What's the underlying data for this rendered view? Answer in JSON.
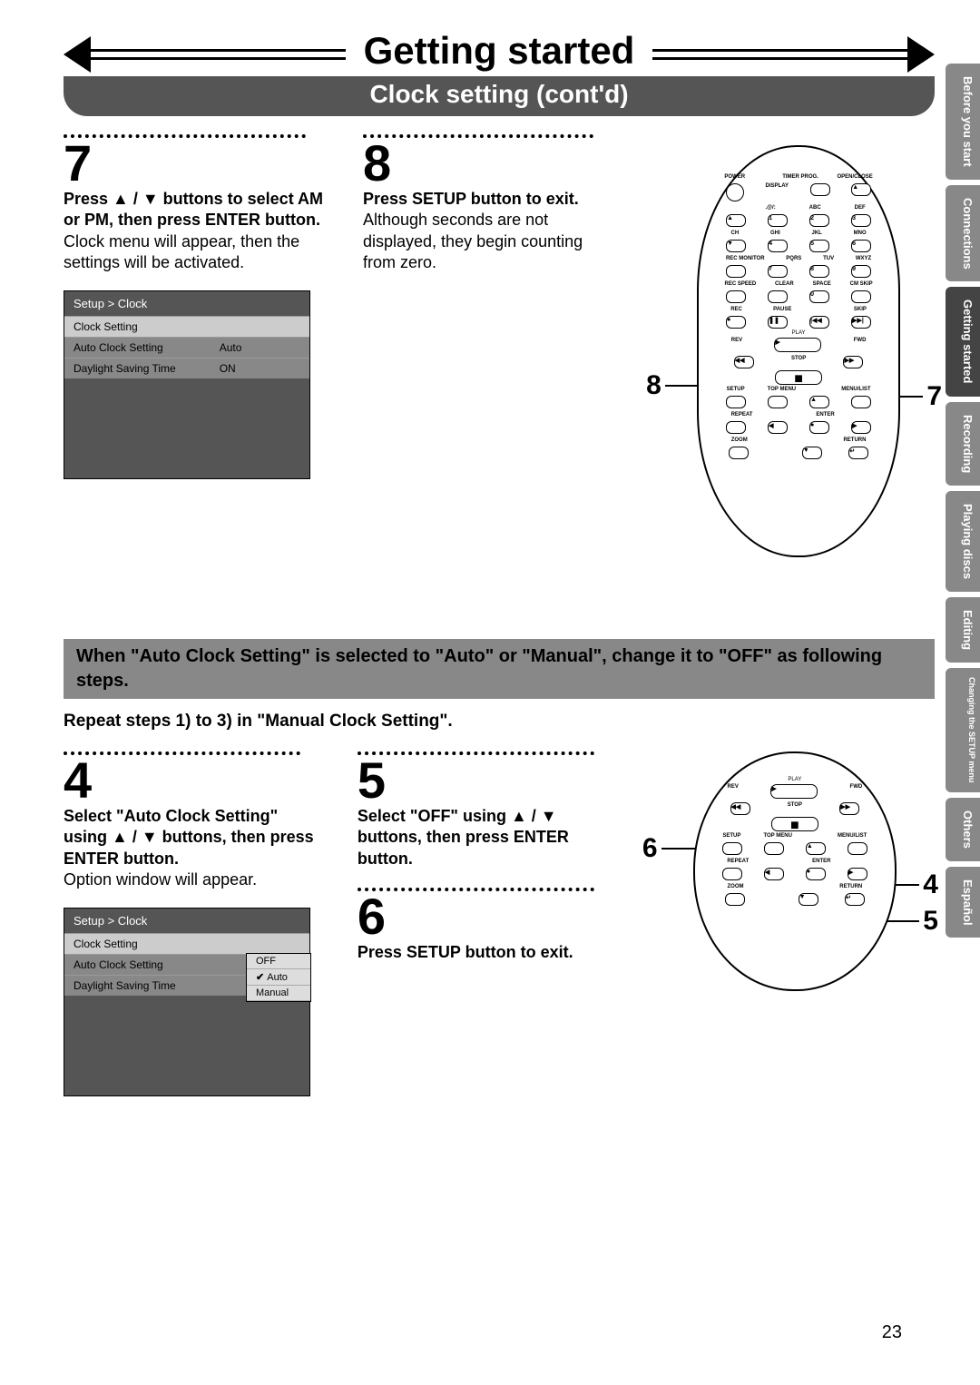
{
  "pageNumber": "23",
  "header": {
    "title": "Getting started",
    "subtitle": "Clock setting (cont'd)"
  },
  "tabs": [
    "Before you start",
    "Connections",
    "Getting started",
    "Recording",
    "Playing discs",
    "Editing",
    "Changing the SETUP menu",
    "Others",
    "Español"
  ],
  "activeTab": "Getting started",
  "step7": {
    "num": "7",
    "bold": "Press ▲ / ▼ buttons to select AM or PM, then press ENTER button.",
    "body": "Clock menu will appear, then the settings will be activated."
  },
  "step8": {
    "num": "8",
    "bold": "Press SETUP button to exit.",
    "body": "Although seconds are not displayed, they begin counting from zero."
  },
  "menu1": {
    "breadcrumb": "Setup > Clock",
    "rows": [
      {
        "label": "Clock Setting",
        "val": ""
      },
      {
        "label": "Auto Clock Setting",
        "val": "Auto"
      },
      {
        "label": "Daylight Saving Time",
        "val": "ON"
      }
    ]
  },
  "noteBar": "When \"Auto Clock Setting\" is selected to \"Auto\" or \"Manual\", change it to \"OFF\" as following steps.",
  "noteSub": "Repeat steps 1) to 3) in \"Manual Clock Setting\".",
  "step4": {
    "num": "4",
    "bold": "Select \"Auto Clock Setting\" using ▲ / ▼ buttons, then press ENTER button.",
    "body": "Option window will appear."
  },
  "step5": {
    "num": "5",
    "bold": "Select \"OFF\" using ▲ / ▼ buttons, then press ENTER button."
  },
  "step6": {
    "num": "6",
    "bold": "Press SETUP button to exit."
  },
  "menu2": {
    "breadcrumb": "Setup > Clock",
    "rows": [
      {
        "label": "Clock Setting",
        "val": ""
      },
      {
        "label": "Auto Clock Setting",
        "val": ""
      },
      {
        "label": "Daylight Saving Time",
        "val": ""
      }
    ],
    "popup": [
      "OFF",
      "Auto",
      "Manual"
    ],
    "popupSelected": "Auto"
  },
  "remoteLabels": {
    "row1": [
      "POWER",
      "",
      "TIMER PROG.",
      "OPEN/CLOSE"
    ],
    "row2": [
      "",
      "DISPLAY",
      "",
      ""
    ],
    "numTop": [
      ".@/:",
      "ABC",
      "DEF"
    ],
    "num1": [
      "1",
      "2",
      "3"
    ],
    "numMid": [
      "CH",
      "GHI",
      "JKL",
      "MNO"
    ],
    "num2": [
      "4",
      "5",
      "6"
    ],
    "numMid2": [
      "REC MONITOR",
      "PQRS",
      "TUV",
      "WXYZ"
    ],
    "num3": [
      "7",
      "8",
      "9"
    ],
    "bot": [
      "REC SPEED",
      "CLEAR",
      "SPACE",
      "CM SKIP"
    ],
    "num0": "0",
    "transport": [
      "REC",
      "PAUSE",
      "",
      "SKIP"
    ],
    "play": "PLAY",
    "rev": "REV",
    "fwd": "FWD",
    "stop": "STOP",
    "menus": [
      "SETUP",
      "TOP MENU",
      "",
      "MENU/LIST"
    ],
    "nav": [
      "REPEAT",
      "",
      "ENTER",
      ""
    ],
    "zoom": "ZOOM",
    "return": "RETURN"
  },
  "callouts": {
    "r1_left": "8",
    "r1_right": "7",
    "r2_left": "6",
    "r2_right_top": "4",
    "r2_right_bot": "5"
  }
}
